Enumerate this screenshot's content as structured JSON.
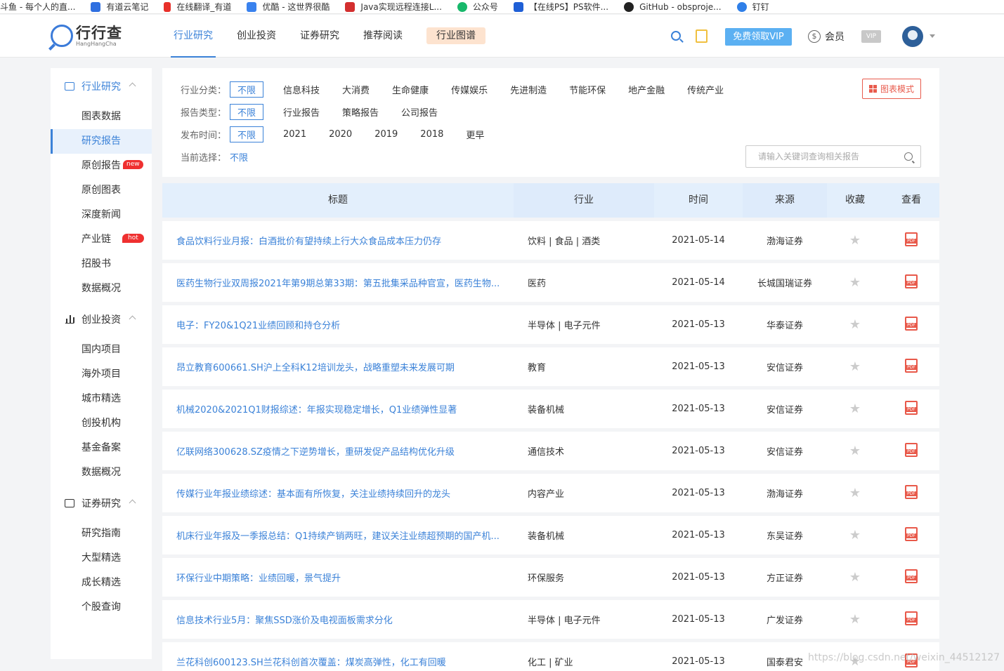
{
  "bookmarks": [
    {
      "label": "斗鱼 - 每个人的直...",
      "color": "#ffffff"
    },
    {
      "label": "有道云笔记",
      "color": "#2f6fe0"
    },
    {
      "label": "在线翻译_有道",
      "color": "#e8302a"
    },
    {
      "label": "优酷 - 这世界很酷",
      "color": "#3a82ee"
    },
    {
      "label": "Java实现远程连接L...",
      "color": "#d32f2f"
    },
    {
      "label": "公众号",
      "color": "#18b86b"
    },
    {
      "label": "【在线PS】PS软件...",
      "color": "#1f5fd6"
    },
    {
      "label": "GitHub - obsproje...",
      "color": "#222222"
    },
    {
      "label": "钉钉",
      "color": "#2f7fe8"
    }
  ],
  "logo": {
    "cn": "行行查",
    "en": "HangHangCha"
  },
  "nav": [
    {
      "label": "行业研究"
    },
    {
      "label": "创业投资"
    },
    {
      "label": "证券研究"
    },
    {
      "label": "推荐阅读"
    },
    {
      "label": "行业图谱"
    }
  ],
  "header": {
    "vip_button": "免费领取VIP",
    "member": "会员",
    "vip_badge": "VIP",
    "dollar": "$"
  },
  "sidebar": {
    "groups": [
      {
        "label": "行业研究",
        "items": [
          "图表数据",
          "研究报告",
          "原创报告",
          "原创图表",
          "深度新闻",
          "产业链",
          "招股书",
          "数据概况"
        ]
      },
      {
        "label": "创业投资",
        "items": [
          "国内项目",
          "海外项目",
          "城市精选",
          "创投机构",
          "基金备案",
          "数据概况"
        ]
      },
      {
        "label": "证券研究",
        "items": [
          "研究指南",
          "大型精选",
          "成长精选",
          "个股查询"
        ]
      }
    ],
    "tags": {
      "new": "new",
      "hot": "hot"
    }
  },
  "filter": {
    "industry_label": "行业分类：",
    "industry_options": [
      "不限",
      "信息科技",
      "大消费",
      "生命健康",
      "传媒娱乐",
      "先进制造",
      "节能环保",
      "地产金融",
      "传统产业"
    ],
    "type_label": "报告类型：",
    "type_options": [
      "不限",
      "行业报告",
      "策略报告",
      "公司报告"
    ],
    "time_label": "发布时间：",
    "time_options": [
      "不限",
      "2021",
      "2020",
      "2019",
      "2018",
      "更早"
    ],
    "current_label": "当前选择：",
    "current_value": "不限",
    "chart_mode": "图表模式",
    "search_placeholder": "请输入关键词查询相关报告"
  },
  "table": {
    "headers": [
      "标题",
      "行业",
      "时间",
      "来源",
      "收藏",
      "查看"
    ],
    "rows": [
      {
        "title": "食品饮料行业月报：白酒批价有望持续上行大众食品成本压力仍存",
        "industry": "饮料 | 食品 | 酒类",
        "date": "2021-05-14",
        "source": "渤海证券"
      },
      {
        "title": "医药生物行业双周报2021年第9期总第33期：第五批集采品种官宣，医药生物...",
        "industry": "医药",
        "date": "2021-05-14",
        "source": "长城国瑞证券"
      },
      {
        "title": "电子：FY20&1Q21业绩回顾和持仓分析",
        "industry": "半导体 | 电子元件",
        "date": "2021-05-13",
        "source": "华泰证券"
      },
      {
        "title": "昂立教育600661.SH沪上全科K12培训龙头，战略重塑未来发展可期",
        "industry": "教育",
        "date": "2021-05-13",
        "source": "安信证券"
      },
      {
        "title": "机械2020&2021Q1财报综述：年报实现稳定增长，Q1业绩弹性显著",
        "industry": "装备机械",
        "date": "2021-05-13",
        "source": "安信证券"
      },
      {
        "title": "亿联网络300628.SZ疫情之下逆势增长，重研发促产品结构优化升级",
        "industry": "通信技术",
        "date": "2021-05-13",
        "source": "安信证券"
      },
      {
        "title": "传媒行业年报业绩综述：基本面有所恢复，关注业绩持续回升的龙头",
        "industry": "内容产业",
        "date": "2021-05-13",
        "source": "渤海证券"
      },
      {
        "title": "机床行业年报及一季报总结：Q1持续产销两旺，建议关注业绩超预期的国产机...",
        "industry": "装备机械",
        "date": "2021-05-13",
        "source": "东吴证券"
      },
      {
        "title": "环保行业中期策略：业绩回暖，景气提升",
        "industry": "环保服务",
        "date": "2021-05-13",
        "source": "方正证券"
      },
      {
        "title": "信息技术行业5月：聚焦SSD涨价及电视面板需求分化",
        "industry": "半导体 | 电子元件",
        "date": "2021-05-13",
        "source": "广发证券"
      },
      {
        "title": "兰花科创600123.SH兰花科创首次覆盖：煤炭高弹性，化工有回暖",
        "industry": "化工 | 矿业",
        "date": "2021-05-13",
        "source": "国泰君安"
      }
    ]
  },
  "watermark": "https://blog.csdn.net/weixin_44512127",
  "colors": {
    "accent": "#3b82d8",
    "pdf": "#e8594a",
    "vip": "#5bb0f2",
    "tag": "#ef3030"
  }
}
